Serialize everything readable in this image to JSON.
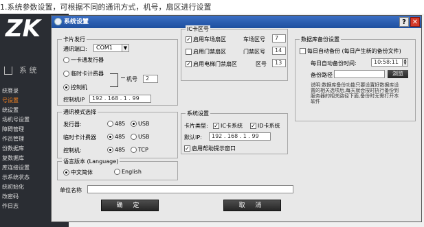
{
  "caption": "1.系统参数设置，可根据不同的通讯方式，机号，扇区进行设置",
  "bg_app": {
    "logo": "ZK",
    "home_label": "系 统",
    "menu": [
      {
        "label": "统登录",
        "active": false
      },
      {
        "label": "号设置",
        "active": true
      },
      {
        "label": "统设置",
        "active": false
      },
      {
        "label": "场机号设置",
        "active": false
      },
      {
        "label": "障碍管理",
        "active": false
      },
      {
        "label": "作员管理",
        "active": false
      },
      {
        "label": "份数据库",
        "active": false
      },
      {
        "label": "复数据库",
        "active": false
      },
      {
        "label": "库连接设置",
        "active": false
      },
      {
        "label": "示系统状态",
        "active": false
      },
      {
        "label": "统初始化",
        "active": false
      },
      {
        "label": "改密码",
        "active": false
      },
      {
        "label": "作日志",
        "active": false
      }
    ]
  },
  "dialog": {
    "title": "系统设置",
    "help_label": "?",
    "close_label": "✕",
    "card_issue": {
      "legend": "卡片发行",
      "port_label": "通讯端口:",
      "port_value": "COM1",
      "opt_one_card": "一卡通发行器",
      "opt_temp_card": "临时卡计费器",
      "opt_controller": "控制机",
      "machine_no_label": "机号",
      "machine_no_value": "2",
      "controller_ip_label": "控制机IP",
      "controller_ip_value": "192 . 168 . 1 . 99"
    },
    "ic_sector": {
      "legend": "IC卡区号",
      "rows": [
        {
          "check_label": "启用车场扇区",
          "field_label": "车场区号",
          "value": "7",
          "checked": true
        },
        {
          "check_label": "启用门禁扇区",
          "field_label": "门禁区号",
          "value": "14",
          "checked": false
        },
        {
          "check_label": "启用电梯门禁扇区",
          "field_label": "区号",
          "value": "13",
          "checked": true
        }
      ]
    },
    "backup": {
      "legend": "数据库备份设置",
      "auto_backup_label": "每日自动备份 (每日产生新的备份文件)",
      "time_label": "每日自动备份时间:",
      "time_value": "10:58:11",
      "path_label": "备份路径",
      "path_value": "",
      "browse_label": "浏览",
      "note": "说明:数据库备份功能只要设置好数据库设置的相关选项后,每天就会按时执行备份到服务器的相关路径下面,备份时无需打开本软件"
    },
    "comm_mode": {
      "legend": "通讯模式选择",
      "rows": [
        {
          "label": "发行器:",
          "opt1": "485",
          "opt2": "USB",
          "selected": 2
        },
        {
          "label": "临时卡计费器",
          "opt1": "485",
          "opt2": "USB",
          "selected": 1
        },
        {
          "label": "控制机:",
          "opt1": "485",
          "opt2": "TCP",
          "selected": 1
        }
      ]
    },
    "sys_settings": {
      "legend": "系统设置",
      "card_type_label": "卡片类型:",
      "ic_label": "IC卡系统",
      "id_label": "ID卡系统",
      "default_ip_label": "默认IP:",
      "default_ip_value": "192 . 168 . 1 . 99",
      "help_popup_label": "启用帮助提示窗口"
    },
    "language": {
      "legend": "语言版本 (Language)",
      "opt_cn": "中文简体",
      "opt_en": "English",
      "selected": "cn"
    },
    "unit_name_label": "单位名称",
    "unit_name_value": "",
    "ok_label": "确 定",
    "cancel_label": "取 消"
  }
}
